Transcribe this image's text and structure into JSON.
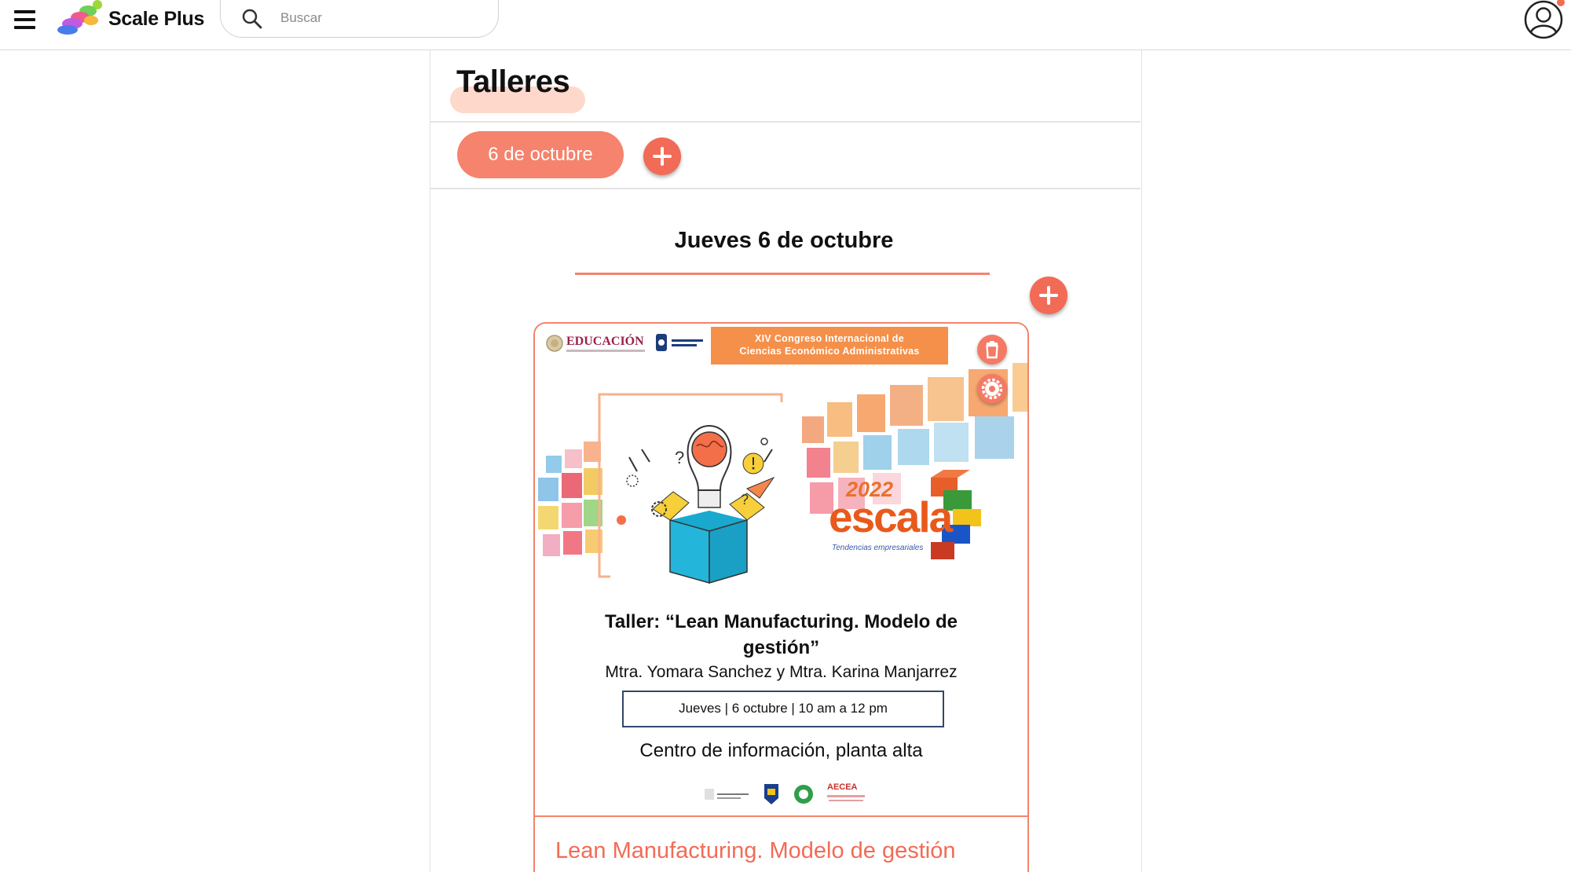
{
  "app": {
    "name": "Scale Plus"
  },
  "search": {
    "placeholder": "Buscar"
  },
  "page": {
    "title": "Talleres"
  },
  "dates": {
    "selected": "6 de octubre"
  },
  "day": {
    "heading": "Jueves 6 de octubre"
  },
  "workshop": {
    "caption": "Lean Manufacturing. Modelo de gestión",
    "poster": {
      "edu_logo": "EDUCACIÓN",
      "congress_line1": "XIV Congreso Internacional de",
      "congress_line2": "Ciencias Económico Administrativas",
      "brand_year": "2022",
      "brand_name": "escala",
      "brand_tagline": "Tendencias empresariales",
      "title_line1": "Taller: “Lean Manufacturing. Modelo de",
      "title_line2": "gestión”",
      "speakers": "Mtra. Yomara Sanchez y Mtra. Karina Manjarrez",
      "info": "Jueves  |   6 octubre   |   10 am a 12 pm",
      "place": "Centro de información, planta alta",
      "sponsor_logo": "AECEA"
    }
  },
  "colors": {
    "accent": "#f26b56",
    "accent_light": "#f5836d",
    "highlight": "#ffd8cc",
    "info_border": "#33476b"
  },
  "icons": [
    "menu-icon",
    "search-icon",
    "user-icon",
    "plus-icon",
    "trash-icon",
    "gear-icon"
  ]
}
